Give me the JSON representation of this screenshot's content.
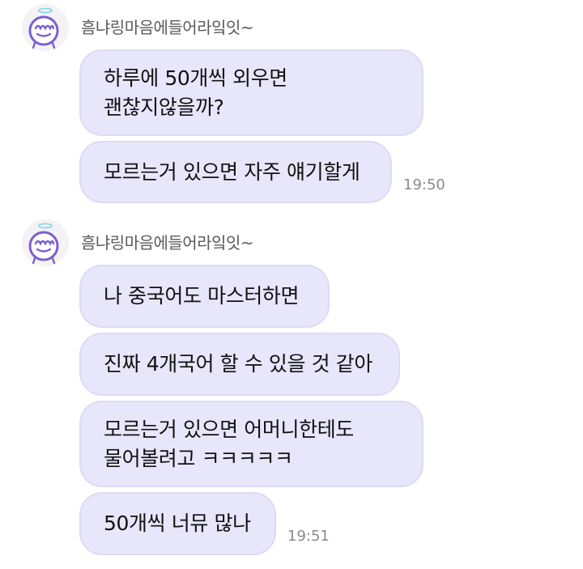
{
  "groups": [
    {
      "sender": "흠냐링마음에들어라잌잇~",
      "avatar_icon": "halo-character-avatar",
      "messages": [
        {
          "lines": [
            "하루에 50개씩 외우면",
            "괜찮지않을까?"
          ]
        },
        {
          "lines": [
            "모르는거 있으면 자주 얘기할게"
          ]
        }
      ],
      "time": "19:50"
    },
    {
      "sender": "흠냐링마음에들어라잌잇~",
      "avatar_icon": "halo-character-avatar",
      "messages": [
        {
          "lines": [
            "나 중국어도 마스터하면"
          ]
        },
        {
          "lines": [
            "진짜 4개국어 할 수 있을 것 같아"
          ]
        },
        {
          "lines": [
            "모르는거 있으면 어머니한테도",
            "물어볼려고 ㅋㅋㅋㅋㅋ"
          ]
        },
        {
          "lines": [
            "50개씩 너뮤 많나"
          ]
        }
      ],
      "time": "19:51"
    }
  ],
  "colors": {
    "bubble": "#e7e6fb",
    "bubble_border": "#dcdbf6",
    "avatar_outline": "#7b5fd1",
    "avatar_halo": "#7fd3ea"
  }
}
